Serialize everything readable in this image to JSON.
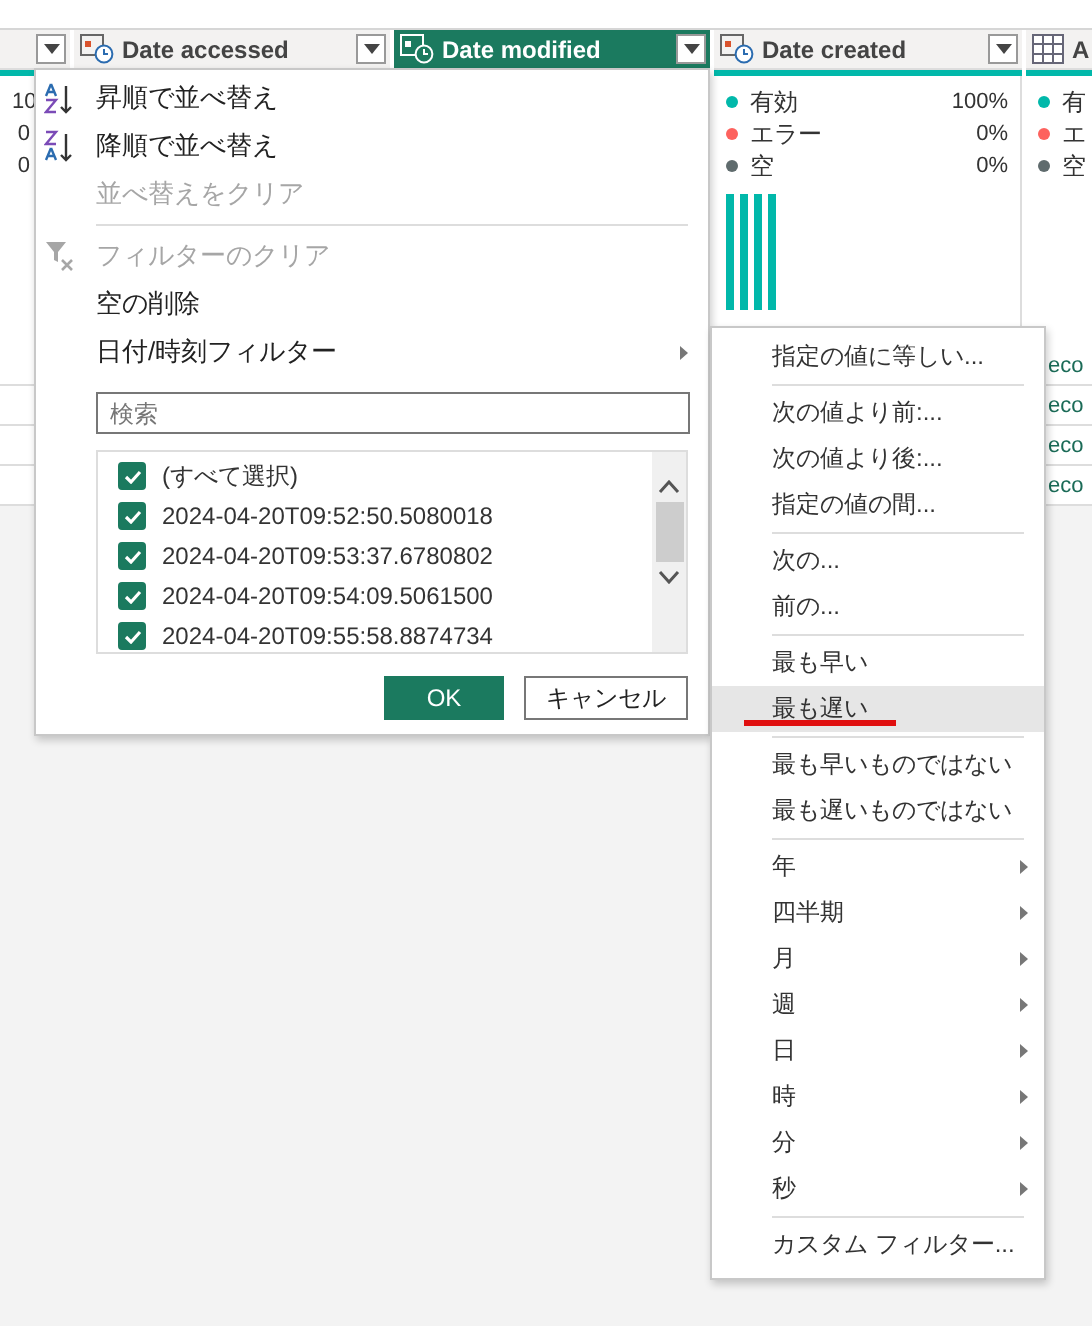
{
  "columns": [
    {
      "kind": "plain",
      "selected": false,
      "stats": [
        {
          "value": "10"
        },
        {
          "value": "0"
        },
        {
          "value": "0"
        }
      ]
    },
    {
      "kind": "datetime",
      "header": "Date accessed",
      "selected": false
    },
    {
      "kind": "datetime",
      "header": "Date modified",
      "selected": true
    },
    {
      "kind": "datetime",
      "header": "Date created",
      "selected": false,
      "histogram": true,
      "stats": [
        {
          "label": "有効",
          "value": "100%",
          "color": "#01b8aa"
        },
        {
          "label": "エラー",
          "value": "0%",
          "color": "#fd625e"
        },
        {
          "label": "空",
          "value": "0%",
          "color": "#5f6b6d"
        }
      ]
    },
    {
      "kind": "table",
      "header": "A",
      "selected": false,
      "stats": [
        {
          "label": "有",
          "color": "#01b8aa"
        },
        {
          "label": "エ",
          "color": "#fd625e"
        },
        {
          "label": "空",
          "color": "#5f6b6d"
        }
      ],
      "cells": [
        "eco",
        "eco",
        "eco",
        "eco"
      ]
    }
  ],
  "menu": {
    "items": [
      {
        "kind": "sort-ascending",
        "label": "昇順で並べ替え",
        "disabled": false
      },
      {
        "kind": "sort-descending",
        "label": "降順で並べ替え",
        "disabled": false
      },
      {
        "kind": "plain",
        "label": "並べ替えをクリア",
        "disabled": true
      },
      {
        "kind": "separator"
      },
      {
        "kind": "clear-filter",
        "label": "フィルターのクリア",
        "disabled": true
      },
      {
        "kind": "plain",
        "label": "空の削除",
        "disabled": false
      },
      {
        "kind": "submenu",
        "label": "日付/時刻フィルター",
        "disabled": false
      }
    ],
    "search": {
      "placeholder": "検索"
    },
    "values": [
      {
        "label": "(すべて選択)",
        "checked": true
      },
      {
        "label": "2024-04-20T09:52:50.5080018",
        "checked": true
      },
      {
        "label": "2024-04-20T09:53:37.6780802",
        "checked": true
      },
      {
        "label": "2024-04-20T09:54:09.5061500",
        "checked": true
      },
      {
        "label": "2024-04-20T09:55:58.8874734",
        "checked": true
      }
    ],
    "buttons": [
      {
        "label": "OK",
        "kind": "primary"
      },
      {
        "label": "キャンセル",
        "kind": "secondary"
      }
    ]
  },
  "submenu": {
    "items": [
      {
        "kind": "item",
        "label": "指定の値に等しい...",
        "selected": false,
        "annotated": false
      },
      {
        "kind": "separator"
      },
      {
        "kind": "item",
        "label": "次の値より前:...",
        "selected": false,
        "annotated": false
      },
      {
        "kind": "item",
        "label": "次の値より後:...",
        "selected": false,
        "annotated": false
      },
      {
        "kind": "item",
        "label": "指定の値の間...",
        "selected": false,
        "annotated": false
      },
      {
        "kind": "separator"
      },
      {
        "kind": "item",
        "label": "次の...",
        "selected": false,
        "annotated": false
      },
      {
        "kind": "item",
        "label": "前の...",
        "selected": false,
        "annotated": false
      },
      {
        "kind": "separator"
      },
      {
        "kind": "item",
        "label": "最も早い",
        "selected": false,
        "annotated": false
      },
      {
        "kind": "item",
        "label": "最も遅い",
        "selected": true,
        "annotated": true
      },
      {
        "kind": "separator"
      },
      {
        "kind": "item",
        "label": "最も早いものではない",
        "selected": false,
        "annotated": false
      },
      {
        "kind": "item",
        "label": "最も遅いものではない",
        "selected": false,
        "annotated": false
      },
      {
        "kind": "separator"
      },
      {
        "kind": "submenu",
        "label": "年",
        "selected": false,
        "annotated": false
      },
      {
        "kind": "submenu",
        "label": "四半期",
        "selected": false,
        "annotated": false
      },
      {
        "kind": "submenu",
        "label": "月",
        "selected": false,
        "annotated": false
      },
      {
        "kind": "submenu",
        "label": "週",
        "selected": false,
        "annotated": false
      },
      {
        "kind": "submenu",
        "label": "日",
        "selected": false,
        "annotated": false
      },
      {
        "kind": "submenu",
        "label": "時",
        "selected": false,
        "annotated": false
      },
      {
        "kind": "submenu",
        "label": "分",
        "selected": false,
        "annotated": false
      },
      {
        "kind": "submenu",
        "label": "秒",
        "selected": false,
        "annotated": false
      },
      {
        "kind": "separator"
      },
      {
        "kind": "item",
        "label": "カスタム フィルター...",
        "selected": false,
        "annotated": false
      }
    ]
  }
}
